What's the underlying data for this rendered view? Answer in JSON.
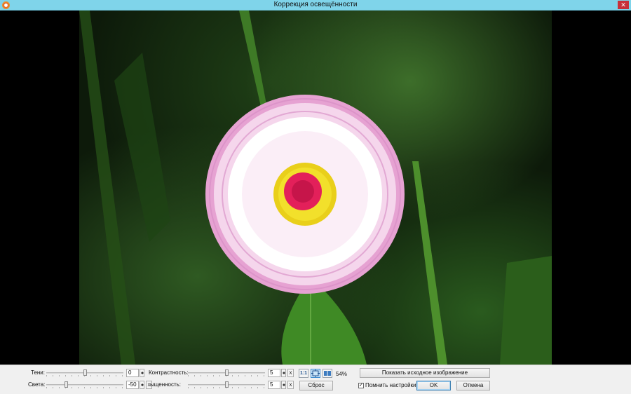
{
  "window": {
    "title": "Коррекция освещённости",
    "close_glyph": "✕"
  },
  "controls": {
    "shadows": {
      "label": "Тени:",
      "value": "0",
      "slider_fraction": 0.5
    },
    "highlights": {
      "label": "Света:",
      "value": "-50",
      "slider_fraction": 0.25,
      "reset_glyph": "x"
    },
    "contrast": {
      "label": "Контрастность:",
      "value": "5",
      "slider_fraction": 0.5,
      "reset_glyph": "x"
    },
    "saturation": {
      "label": "Насыщенность:",
      "visible_label": "ыщенность:",
      "value": "5",
      "slider_fraction": 0.5,
      "reset_glyph": "x"
    }
  },
  "zoom": {
    "actual_size_label": "1:1",
    "fit_icon": "fit-icon",
    "split_icon": "split-view-icon",
    "value": "54%"
  },
  "buttons": {
    "show_original": "Показать исходное изображение",
    "reset": "Сброс",
    "ok": "OK",
    "cancel": "Отмена"
  },
  "remember": {
    "label": "Помнить настройки",
    "checked": true,
    "check_glyph": "✓"
  },
  "colors": {
    "titlebar": "#7fd4ea",
    "close": "#c7303a",
    "accent": "#3c8bd0"
  }
}
